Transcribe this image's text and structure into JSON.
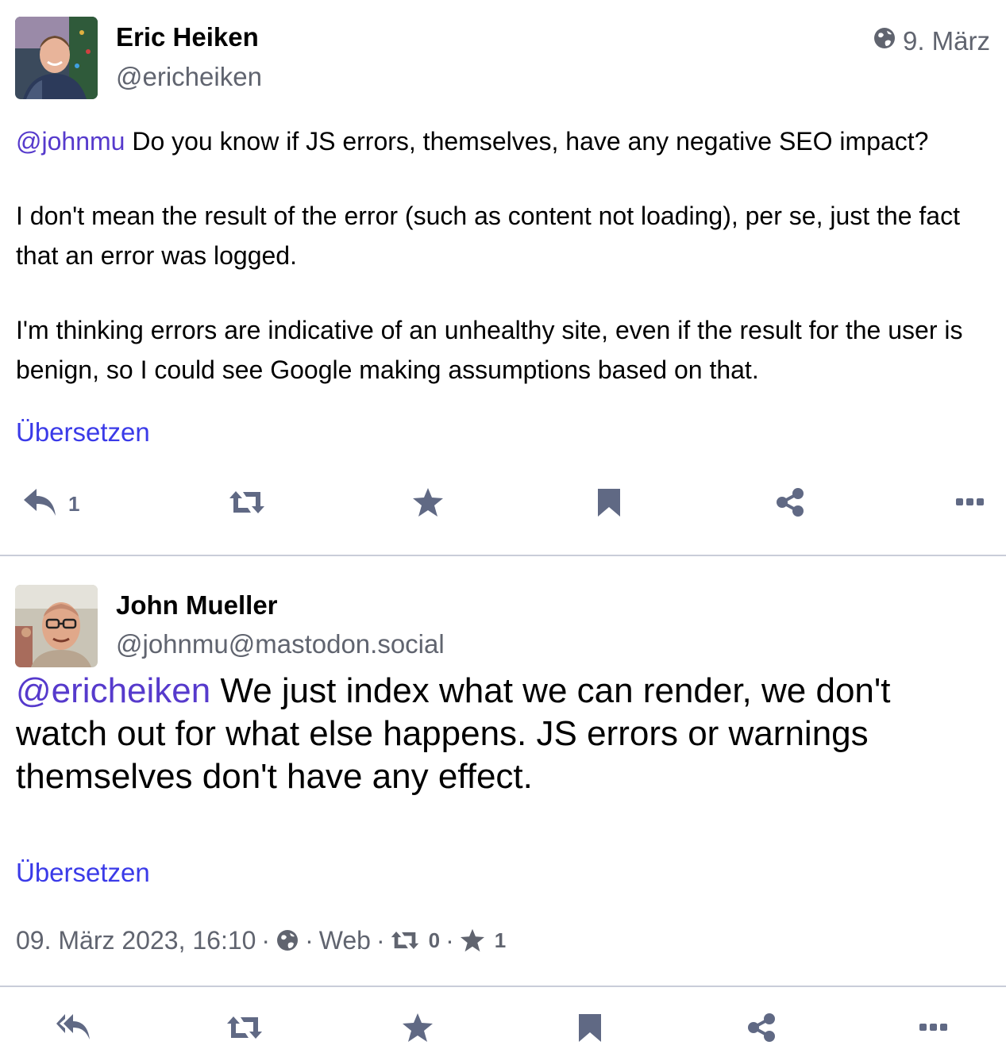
{
  "posts": [
    {
      "author": {
        "display_name": "Eric Heiken",
        "handle": "@ericheiken"
      },
      "visibility_icon": "globe-icon",
      "date": "9. März",
      "mention": "@johnmu",
      "paragraph1_rest": " Do you know if JS errors, themselves, have any negative SEO impact?",
      "paragraph2": "I don't mean the result of the error (such as content not loading), per se, just the fact that an error was logged.",
      "paragraph3": "I'm thinking errors are indicative of an unhealthy site, even if the result for the user is benign, so I could see Google making assumptions based on that.",
      "translate_label": "Übersetzen",
      "actions": {
        "reply_icon": "reply-icon",
        "reply_count": "1",
        "boost_icon": "retweet-icon",
        "favourite_icon": "star-icon",
        "bookmark_icon": "bookmark-icon",
        "share_icon": "share-icon",
        "more_icon": "ellipsis-icon"
      }
    },
    {
      "author": {
        "display_name": "John Mueller",
        "handle": "@johnmu@mastodon.social"
      },
      "mention": "@ericheiken",
      "text_rest": " We just index what we can render, we don't watch out for what else happens. JS errors or warnings themselves don't have any effect.",
      "translate_label": "Übersetzen",
      "meta": {
        "datetime": "09. März 2023, 16:10",
        "separator": "·",
        "visibility_icon": "globe-icon",
        "application": "Web",
        "boost_count": "0",
        "favourite_count": "1"
      }
    }
  ],
  "colors": {
    "mention": "#563acc",
    "link": "#3a3ae8",
    "secondary_text": "#60646f",
    "action_icon": "#606984",
    "divider": "#c9cdd9"
  }
}
